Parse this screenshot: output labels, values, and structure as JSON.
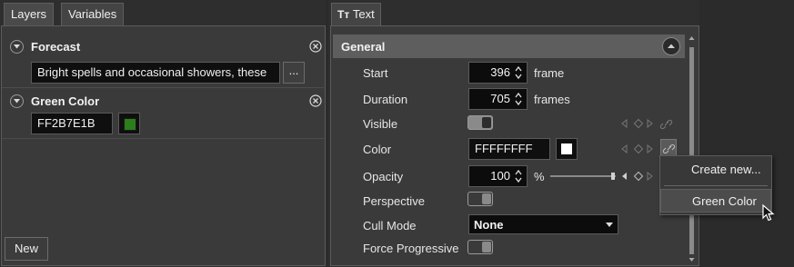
{
  "left_panel": {
    "tabs": [
      {
        "label": "Layers"
      },
      {
        "label": "Variables"
      }
    ],
    "variables": [
      {
        "name": "Forecast",
        "value": "Bright spells and occasional showers, these",
        "more_label": "..."
      },
      {
        "name": "Green Color",
        "value": "FF2B7E1B",
        "swatch_color": "#2b7e1b"
      }
    ],
    "new_button": "New"
  },
  "right_panel": {
    "tab": {
      "icon_text": "Tт",
      "label": "Text"
    },
    "section": "General",
    "properties": {
      "start": {
        "label": "Start",
        "value": "396",
        "unit": "frame"
      },
      "duration": {
        "label": "Duration",
        "value": "705",
        "unit": "frames"
      },
      "visible": {
        "label": "Visible",
        "on": true
      },
      "color": {
        "label": "Color",
        "value": "FFFFFFFF",
        "swatch_color": "#ffffff"
      },
      "opacity": {
        "label": "Opacity",
        "value": "100",
        "unit": "%",
        "slider_level": 1.0
      },
      "perspective": {
        "label": "Perspective",
        "on": false
      },
      "cull_mode": {
        "label": "Cull Mode",
        "value": "None"
      },
      "force_progressive": {
        "label": "Force Progressive",
        "on": false
      }
    }
  },
  "context_menu": {
    "items": [
      {
        "label": "Create new..."
      },
      {
        "label": "Green Color",
        "hovered": true
      }
    ]
  }
}
